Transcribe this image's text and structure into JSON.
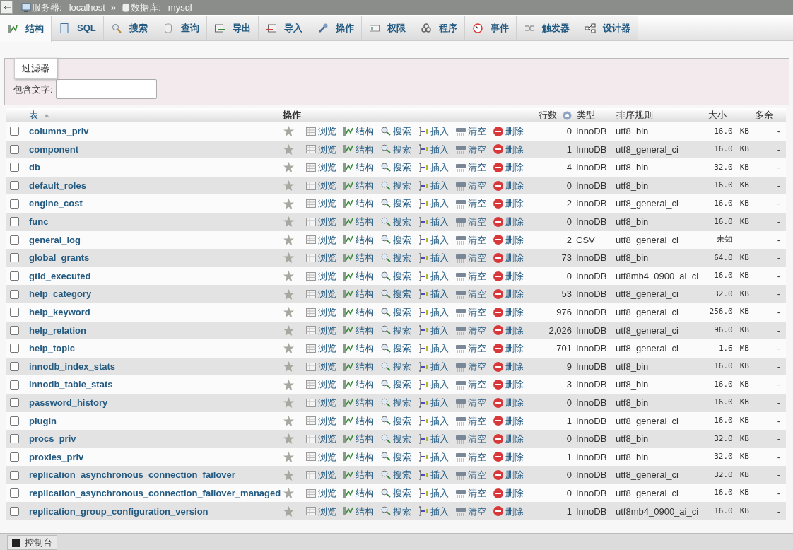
{
  "breadcrumb": {
    "separator": "»",
    "items": [
      {
        "label": "服务器:",
        "value": "localhost",
        "kind": "server"
      },
      {
        "label": "数据库:",
        "value": "mysql",
        "kind": "database"
      }
    ]
  },
  "tabs": [
    {
      "label": "结构",
      "selected": true
    },
    {
      "label": "SQL",
      "selected": false
    },
    {
      "label": "搜索",
      "selected": false
    },
    {
      "label": "查询",
      "selected": false
    },
    {
      "label": "导出",
      "selected": false
    },
    {
      "label": "导入",
      "selected": false
    },
    {
      "label": "操作",
      "selected": false
    },
    {
      "label": "权限",
      "selected": false
    },
    {
      "label": "程序",
      "selected": false
    },
    {
      "label": "事件",
      "selected": false
    },
    {
      "label": "触发器",
      "selected": false
    },
    {
      "label": "设计器",
      "selected": false
    }
  ],
  "filter": {
    "legend": "过滤器",
    "label": "包含文字:"
  },
  "table": {
    "columns": [
      "表",
      "操作",
      "行数",
      "类型",
      "排序规则",
      "大小",
      "多余"
    ],
    "rows": [
      {
        "name": "columns_priv",
        "checked": false,
        "actions": [
          "浏览",
          "结构",
          "搜索",
          "插入",
          "清空",
          "删除"
        ],
        "rows": "0",
        "type": "InnoDB",
        "collation": "utf8_bin",
        "size": "16.0",
        "unit": "KB",
        "overhead": "-"
      },
      {
        "name": "component",
        "checked": false,
        "actions": [
          "浏览",
          "结构",
          "搜索",
          "插入",
          "清空",
          "删除"
        ],
        "rows": "1",
        "type": "InnoDB",
        "collation": "utf8_general_ci",
        "size": "16.0",
        "unit": "KB",
        "overhead": "-"
      },
      {
        "name": "db",
        "checked": false,
        "actions": [
          "浏览",
          "结构",
          "搜索",
          "插入",
          "清空",
          "删除"
        ],
        "rows": "4",
        "type": "InnoDB",
        "collation": "utf8_bin",
        "size": "32.0",
        "unit": "KB",
        "overhead": "-"
      },
      {
        "name": "default_roles",
        "checked": false,
        "actions": [
          "浏览",
          "结构",
          "搜索",
          "插入",
          "清空",
          "删除"
        ],
        "rows": "0",
        "type": "InnoDB",
        "collation": "utf8_bin",
        "size": "16.0",
        "unit": "KB",
        "overhead": "-"
      },
      {
        "name": "engine_cost",
        "checked": false,
        "actions": [
          "浏览",
          "结构",
          "搜索",
          "插入",
          "清空",
          "删除"
        ],
        "rows": "2",
        "type": "InnoDB",
        "collation": "utf8_general_ci",
        "size": "16.0",
        "unit": "KB",
        "overhead": "-"
      },
      {
        "name": "func",
        "checked": false,
        "actions": [
          "浏览",
          "结构",
          "搜索",
          "插入",
          "清空",
          "删除"
        ],
        "rows": "0",
        "type": "InnoDB",
        "collation": "utf8_bin",
        "size": "16.0",
        "unit": "KB",
        "overhead": "-"
      },
      {
        "name": "general_log",
        "checked": false,
        "actions": [
          "浏览",
          "结构",
          "搜索",
          "插入",
          "清空",
          "删除"
        ],
        "rows": "2",
        "type": "CSV",
        "collation": "utf8_general_ci",
        "size": "未知",
        "overhead": "-"
      },
      {
        "name": "global_grants",
        "checked": false,
        "actions": [
          "浏览",
          "结构",
          "搜索",
          "插入",
          "清空",
          "删除"
        ],
        "rows": "73",
        "type": "InnoDB",
        "collation": "utf8_bin",
        "size": "64.0",
        "unit": "KB",
        "overhead": "-"
      },
      {
        "name": "gtid_executed",
        "checked": false,
        "actions": [
          "浏览",
          "结构",
          "搜索",
          "插入",
          "清空",
          "删除"
        ],
        "rows": "0",
        "type": "InnoDB",
        "collation": "utf8mb4_0900_ai_ci",
        "size": "16.0",
        "unit": "KB",
        "overhead": "-"
      },
      {
        "name": "help_category",
        "checked": false,
        "actions": [
          "浏览",
          "结构",
          "搜索",
          "插入",
          "清空",
          "删除"
        ],
        "rows": "53",
        "type": "InnoDB",
        "collation": "utf8_general_ci",
        "size": "32.0",
        "unit": "KB",
        "overhead": "-"
      },
      {
        "name": "help_keyword",
        "checked": false,
        "actions": [
          "浏览",
          "结构",
          "搜索",
          "插入",
          "清空",
          "删除"
        ],
        "rows": "976",
        "type": "InnoDB",
        "collation": "utf8_general_ci",
        "size": "256.0",
        "unit": "KB",
        "overhead": "-"
      },
      {
        "name": "help_relation",
        "checked": false,
        "actions": [
          "浏览",
          "结构",
          "搜索",
          "插入",
          "清空",
          "删除"
        ],
        "rows": "2,026",
        "type": "InnoDB",
        "collation": "utf8_general_ci",
        "size": "96.0",
        "unit": "KB",
        "overhead": "-"
      },
      {
        "name": "help_topic",
        "checked": false,
        "actions": [
          "浏览",
          "结构",
          "搜索",
          "插入",
          "清空",
          "删除"
        ],
        "rows": "701",
        "type": "InnoDB",
        "collation": "utf8_general_ci",
        "size": "1.6",
        "unit": "MB",
        "overhead": "-"
      },
      {
        "name": "innodb_index_stats",
        "checked": false,
        "actions": [
          "浏览",
          "结构",
          "搜索",
          "插入",
          "清空",
          "删除"
        ],
        "rows": "9",
        "type": "InnoDB",
        "collation": "utf8_bin",
        "size": "16.0",
        "unit": "KB",
        "overhead": "-"
      },
      {
        "name": "innodb_table_stats",
        "checked": false,
        "actions": [
          "浏览",
          "结构",
          "搜索",
          "插入",
          "清空",
          "删除"
        ],
        "rows": "3",
        "type": "InnoDB",
        "collation": "utf8_bin",
        "size": "16.0",
        "unit": "KB",
        "overhead": "-"
      },
      {
        "name": "password_history",
        "checked": false,
        "actions": [
          "浏览",
          "结构",
          "搜索",
          "插入",
          "清空",
          "删除"
        ],
        "rows": "0",
        "type": "InnoDB",
        "collation": "utf8_bin",
        "size": "16.0",
        "unit": "KB",
        "overhead": "-"
      },
      {
        "name": "plugin",
        "checked": false,
        "actions": [
          "浏览",
          "结构",
          "搜索",
          "插入",
          "清空",
          "删除"
        ],
        "rows": "1",
        "type": "InnoDB",
        "collation": "utf8_general_ci",
        "size": "16.0",
        "unit": "KB",
        "overhead": "-"
      },
      {
        "name": "procs_priv",
        "checked": false,
        "actions": [
          "浏览",
          "结构",
          "搜索",
          "插入",
          "清空",
          "删除"
        ],
        "rows": "0",
        "type": "InnoDB",
        "collation": "utf8_bin",
        "size": "32.0",
        "unit": "KB",
        "overhead": "-"
      },
      {
        "name": "proxies_priv",
        "checked": false,
        "actions": [
          "浏览",
          "结构",
          "搜索",
          "插入",
          "清空",
          "删除"
        ],
        "rows": "1",
        "type": "InnoDB",
        "collation": "utf8_bin",
        "size": "32.0",
        "unit": "KB",
        "overhead": "-"
      },
      {
        "name": "replication_asynchronous_connection_failover",
        "checked": false,
        "actions": [
          "浏览",
          "结构",
          "搜索",
          "插入",
          "清空",
          "删除"
        ],
        "rows": "0",
        "type": "InnoDB",
        "collation": "utf8_general_ci",
        "size": "32.0",
        "unit": "KB",
        "overhead": "-"
      },
      {
        "name": "replication_asynchronous_connection_failover_managed",
        "checked": false,
        "actions": [
          "浏览",
          "结构",
          "搜索",
          "插入",
          "清空",
          "删除"
        ],
        "rows": "0",
        "type": "InnoDB",
        "collation": "utf8_general_ci",
        "size": "16.0",
        "unit": "KB",
        "overhead": "-"
      },
      {
        "name": "replication_group_configuration_version",
        "checked": false,
        "actions": [
          "浏览",
          "结构",
          "搜索",
          "插入",
          "清空",
          "删除"
        ],
        "rows": "1",
        "type": "InnoDB",
        "collation": "utf8mb4_0900_ai_ci",
        "size": "16.0",
        "unit": "KB",
        "overhead": "-"
      }
    ]
  },
  "console": {
    "label": "控制台"
  }
}
